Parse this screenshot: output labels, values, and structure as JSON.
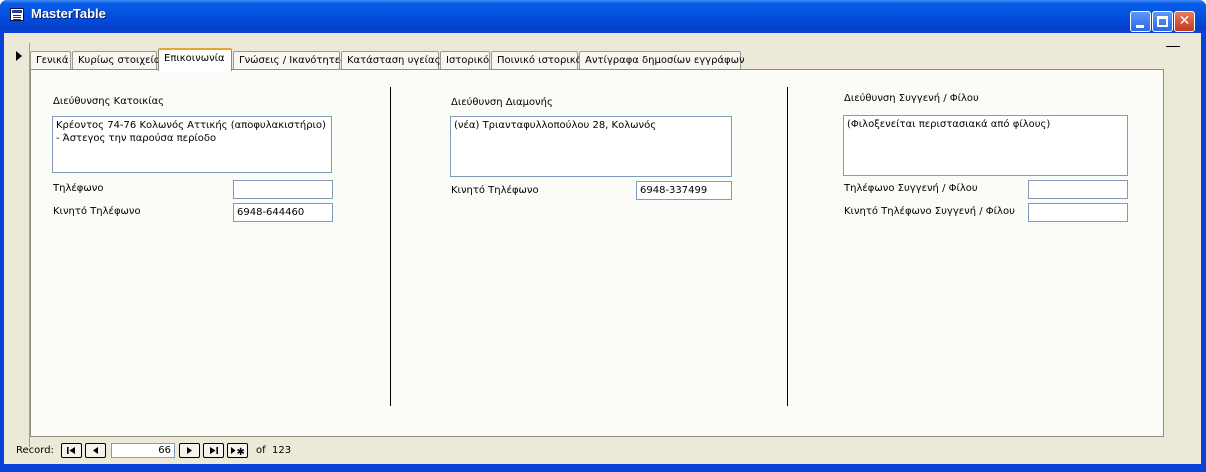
{
  "window": {
    "title": "MasterTable"
  },
  "tabs": [
    {
      "label": "Γενικά"
    },
    {
      "label": "Κυρίως στοιχεία"
    },
    {
      "label": "Επικοινωνία"
    },
    {
      "label": "Γνώσεις / Ικανότητες"
    },
    {
      "label": "Κατάσταση υγείας"
    },
    {
      "label": "Ιστορικό"
    },
    {
      "label": "Ποινικό ιστορικό"
    },
    {
      "label": "Αντίγραφα δημοσίων εγγράφων"
    }
  ],
  "active_tab": "Επικοινωνία",
  "col1": {
    "address_label": "Διεύθυνσης Κατοικίας",
    "address_value": "Κρέοντος 74-76 Κολωνός Αττικής (αποφυλακιστήριο) - Άστεγος την παρούσα περίοδο",
    "phone_label": "Τηλέφωνο",
    "phone_value": "",
    "mobile_label": "Κινητό Τηλέφωνο",
    "mobile_value": "6948-644460"
  },
  "col2": {
    "address_label": "Διεύθυνση Διαμονής",
    "address_value": "(νέα) Τριανταφυλλοπούλου 28, Κολωνός",
    "mobile_label": "Κινητό Τηλέφωνο",
    "mobile_value": "6948-337499"
  },
  "col3": {
    "address_label": "Διεύθυνση Συγγενή / Φίλου",
    "address_value": "(Φιλοξενείται περιστασιακά από φίλους)",
    "phone_label": "Τηλέφωνο Συγγενή / Φίλου",
    "phone_value": "",
    "mobile_label": "Κινητό Τηλέφωνο Συγγενή / Φίλου",
    "mobile_value": ""
  },
  "navigation": {
    "record_label": "Record:",
    "current": "66",
    "of_label": "of",
    "total": "123"
  }
}
